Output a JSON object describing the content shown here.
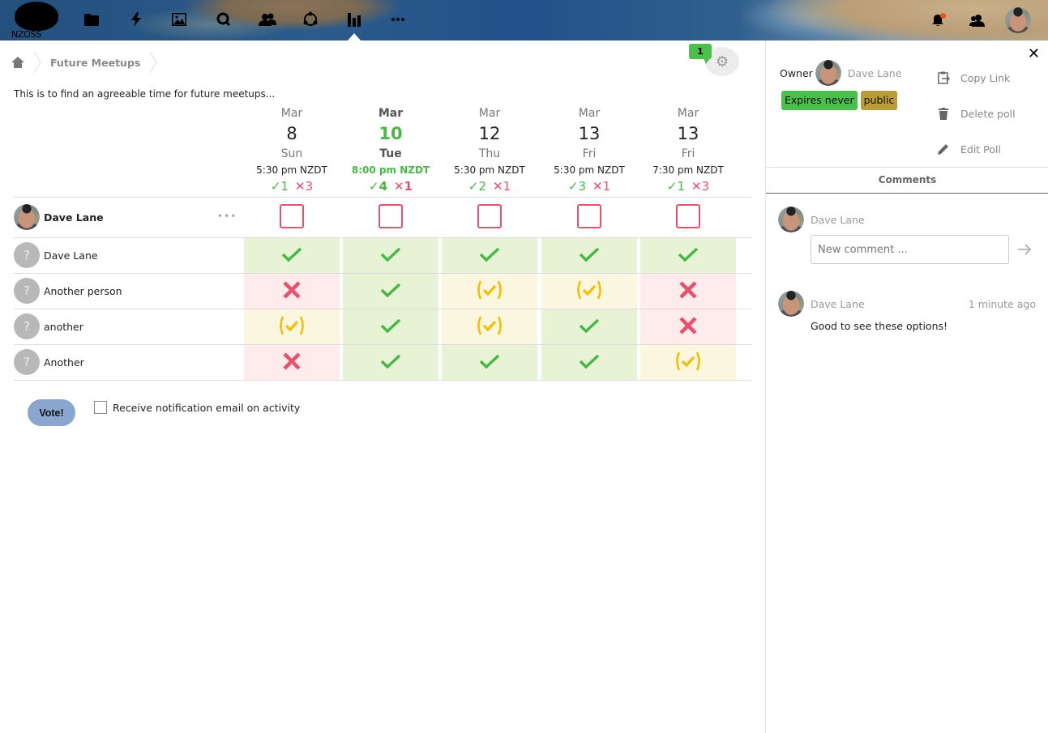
{
  "header": {
    "logo_text": "NZOSS",
    "nav_icons": [
      "files-icon",
      "activity-icon",
      "photos-icon",
      "search-icon",
      "contacts-icon",
      "circles-icon",
      "polls-icon",
      "more-apps-icon"
    ],
    "active_nav": "polls-icon",
    "right_icons": [
      "notifications-icon",
      "contacts-menu-icon",
      "user-avatar"
    ],
    "notification_dot_color": "#e8501a"
  },
  "breadcrumb": {
    "home_icon": "home-icon",
    "current": "Future Meetups"
  },
  "poll": {
    "description": "This is to find an agreeable time for future meetups...",
    "comment_badge_count": "1",
    "options": [
      {
        "month": "Mar",
        "day": "8",
        "dow": "Sun",
        "time": "5:30 pm NZDT",
        "yes": "1",
        "no": "3",
        "best": false
      },
      {
        "month": "Mar",
        "day": "10",
        "dow": "Tue",
        "time": "8:00 pm NZDT",
        "yes": "4",
        "no": "1",
        "best": true
      },
      {
        "month": "Mar",
        "day": "12",
        "dow": "Thu",
        "time": "5:30 pm NZDT",
        "yes": "2",
        "no": "1",
        "best": false
      },
      {
        "month": "Mar",
        "day": "13",
        "dow": "Fri",
        "time": "5:30 pm NZDT",
        "yes": "3",
        "no": "1",
        "best": false
      },
      {
        "month": "Mar",
        "day": "13",
        "dow": "Fri",
        "time": "7:30 pm NZDT",
        "yes": "1",
        "no": "3",
        "best": false
      }
    ],
    "current_user": {
      "name": "Dave Lane",
      "menu_label": "•••"
    },
    "participants": [
      {
        "name": "Dave Lane",
        "avatar": "?",
        "votes": [
          "yes",
          "yes",
          "yes",
          "yes",
          "yes"
        ]
      },
      {
        "name": "Another person",
        "avatar": "?",
        "votes": [
          "no",
          "yes",
          "maybe",
          "maybe",
          "no"
        ]
      },
      {
        "name": "another",
        "avatar": "?",
        "votes": [
          "maybe",
          "yes",
          "maybe",
          "yes",
          "no"
        ]
      },
      {
        "name": "Another",
        "avatar": "?",
        "votes": [
          "no",
          "yes",
          "yes",
          "yes",
          "maybe"
        ]
      }
    ],
    "vote_button": "Vote!",
    "notify_label": "Receive notification email on activity",
    "notify_checked": false,
    "colors": {
      "yes": "#45b845",
      "no": "#e9506d",
      "maybe": "#f5be00"
    }
  },
  "sidebar": {
    "owner_label": "Owner",
    "owner_name": "Dave Lane",
    "badges": [
      {
        "label": "Expires never",
        "color": "#4bbf4b"
      },
      {
        "label": "public",
        "color": "#b89d3a"
      }
    ],
    "actions": [
      {
        "label": "Copy Link",
        "icon": "clipboard-icon"
      },
      {
        "label": "Delete poll",
        "icon": "trash-icon"
      },
      {
        "label": "Edit Poll",
        "icon": "pencil-icon"
      }
    ],
    "tab_label": "Comments",
    "new_comment": {
      "author": "Dave Lane",
      "placeholder": "New comment ...",
      "value": ""
    },
    "comments": [
      {
        "author": "Dave Lane",
        "time": "1 minute ago",
        "text": "Good to see these options!"
      }
    ]
  }
}
